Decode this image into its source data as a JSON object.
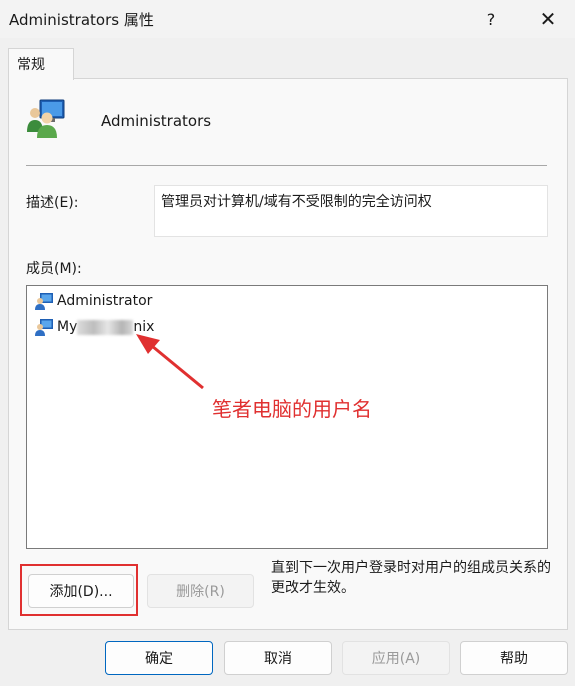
{
  "window": {
    "title": "Administrators 属性",
    "help_glyph": "?",
    "close_glyph": "✕"
  },
  "tabs": [
    {
      "label": "常规"
    }
  ],
  "group": {
    "name": "Administrators",
    "icon": "user-group-icon"
  },
  "description": {
    "label": "描述(E):",
    "value": "管理员对计算机/域有不受限制的完全访问权"
  },
  "members": {
    "label": "成员(M):",
    "items": [
      {
        "icon": "user-icon",
        "name": "Administrator"
      },
      {
        "icon": "user-icon",
        "name_prefix": "My",
        "name_suffix": "nix",
        "obscured": true
      }
    ]
  },
  "annotation": {
    "text": "笔者电脑的用户名",
    "color": "#e03030"
  },
  "hint": "直到下一次用户登录时对用户的组成员关系的更改才生效。",
  "buttons": {
    "add": "添加(D)...",
    "remove": "删除(R)",
    "ok": "确定",
    "cancel": "取消",
    "apply": "应用(A)",
    "help": "帮助"
  },
  "colors": {
    "accent": "#0067c0",
    "annotation": "#e03030"
  }
}
